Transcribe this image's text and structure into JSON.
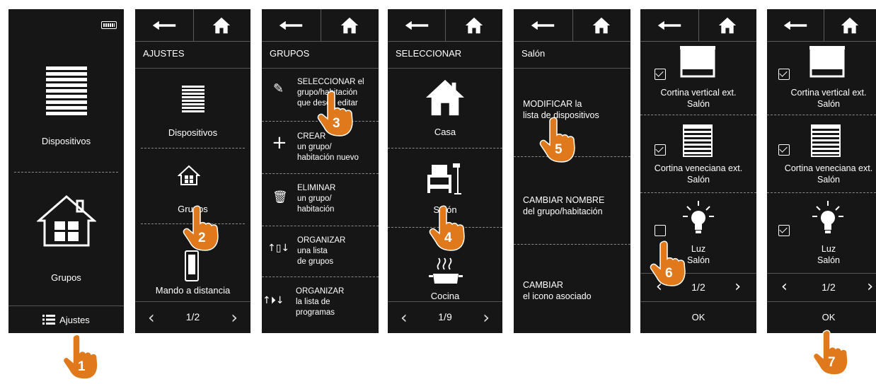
{
  "screens": {
    "s1": {
      "items": [
        "Dispositivos",
        "Grupos"
      ],
      "bottom_label": "Ajustes"
    },
    "s2": {
      "title": "AJUSTES",
      "items": [
        "Dispositivos",
        "Grupos",
        "Mando a distancia"
      ],
      "page": "1/2"
    },
    "s3": {
      "title": "GRUPOS",
      "items": [
        "SELECCIONAR el\ngrupo/habitación\nque desea editar",
        "CREAR\nun grupo/\nhabitación nuevo",
        "ELIMINAR\nun grupo/\nhabitación",
        "ORGANIZAR\nuna lista\nde grupos",
        "ORGANIZAR\nla lista de\nprogramas"
      ]
    },
    "s4": {
      "title": "SELECCIONAR",
      "items": [
        "Casa",
        "Salón",
        "Cocina"
      ],
      "page": "1/9"
    },
    "s5": {
      "title": "Salón",
      "items": [
        "MODIFICAR la\nlista de dispositivos",
        "CAMBIAR NOMBRE\ndel grupo/habitación",
        "CAMBIAR\nel icono asociado"
      ]
    },
    "s6": {
      "devices": [
        {
          "label": "Cortina vertical ext.\nSalón",
          "checked": true
        },
        {
          "label": "Cortina veneciana ext.\nSalón",
          "checked": true
        },
        {
          "label": "Luz\nSalón",
          "checked": false
        }
      ],
      "page": "1/2",
      "ok": "OK"
    },
    "s7": {
      "devices": [
        {
          "label": "Cortina vertical ext.\nSalón",
          "checked": true
        },
        {
          "label": "Cortina veneciana ext.\nSalón",
          "checked": true
        },
        {
          "label": "Luz\nSalón",
          "checked": true
        }
      ],
      "page": "1/2",
      "ok": "OK"
    }
  },
  "steps": [
    "1",
    "2",
    "3",
    "4",
    "5",
    "6",
    "7"
  ],
  "colors": {
    "screen_bg": "#161616",
    "hand": "#e0781c",
    "text": "#ffffff"
  }
}
